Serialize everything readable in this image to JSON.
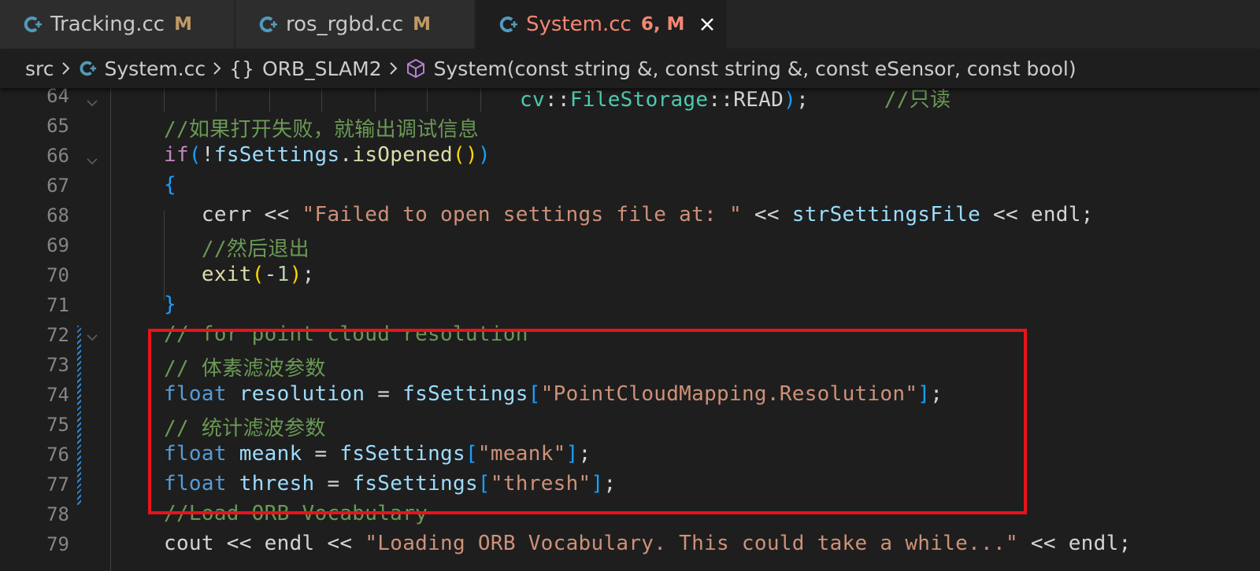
{
  "tabs": [
    {
      "label": "Tracking.cc",
      "badge": "M",
      "icon": "cpp-file-icon"
    },
    {
      "label": "ros_rgbd.cc",
      "badge": "M",
      "icon": "cpp-file-icon"
    },
    {
      "label": "System.cc",
      "badge": "6, M",
      "icon": "cpp-file-icon",
      "active": true
    }
  ],
  "breadcrumb": {
    "folder": "src",
    "file": "System.cc",
    "namespace_braces": "{}",
    "namespace": "ORB_SLAM2",
    "symbol": "System(const string &, const string &, const eSensor, const bool)"
  },
  "editor": {
    "lines": [
      {
        "n": "64",
        "tokens": [
          [
            "cv",
            "c-type"
          ],
          [
            "::",
            "c-plain"
          ],
          [
            "FileStorage",
            "c-type"
          ],
          [
            "::",
            "c-plain"
          ],
          [
            "READ",
            "c-plain"
          ],
          [
            ")",
            "c-p3"
          ],
          [
            ";",
            "c-plain"
          ],
          [
            "      ",
            "c-plain"
          ],
          [
            "//只读",
            "c-cmt"
          ]
        ]
      },
      {
        "n": "65",
        "tokens": [
          [
            "//如果打开失败，就输出调试信息",
            "c-cmt"
          ]
        ]
      },
      {
        "n": "66",
        "tokens": [
          [
            "if",
            "c-ctrl"
          ],
          [
            "(",
            "c-p3"
          ],
          [
            "!",
            "c-plain"
          ],
          [
            "fsSettings",
            "c-var"
          ],
          [
            ".",
            "c-plain"
          ],
          [
            "isOpened",
            "c-fn"
          ],
          [
            "(",
            "c-p1"
          ],
          [
            ")",
            "c-p1"
          ],
          [
            ")",
            "c-p3"
          ]
        ]
      },
      {
        "n": "67",
        "tokens": [
          [
            "{",
            "c-p3"
          ]
        ]
      },
      {
        "n": "68",
        "tokens": [
          [
            "   cerr ",
            "c-plain"
          ],
          [
            "<<",
            "c-plain"
          ],
          [
            " ",
            "c-plain"
          ],
          [
            "\"Failed to open settings file at: \"",
            "c-str"
          ],
          [
            " << ",
            "c-plain"
          ],
          [
            "strSettingsFile",
            "c-var"
          ],
          [
            " << endl;",
            "c-plain"
          ]
        ]
      },
      {
        "n": "69",
        "tokens": [
          [
            "   ",
            "c-plain"
          ],
          [
            "//然后退出",
            "c-cmt"
          ]
        ]
      },
      {
        "n": "70",
        "tokens": [
          [
            "   ",
            "c-plain"
          ],
          [
            "exit",
            "c-fn"
          ],
          [
            "(",
            "c-p1"
          ],
          [
            "-",
            "c-plain"
          ],
          [
            "1",
            "c-num"
          ],
          [
            ")",
            "c-p1"
          ],
          [
            ";",
            "c-plain"
          ]
        ]
      },
      {
        "n": "71",
        "tokens": [
          [
            "}",
            "c-p3"
          ]
        ]
      },
      {
        "n": "72",
        "tokens": [
          [
            "// for point cloud resolution",
            "c-cmt"
          ]
        ]
      },
      {
        "n": "73",
        "tokens": [
          [
            "// 体素滤波参数",
            "c-cmt"
          ]
        ]
      },
      {
        "n": "74",
        "tokens": [
          [
            "float",
            "c-kw"
          ],
          [
            " ",
            "c-plain"
          ],
          [
            "resolution",
            "c-var"
          ],
          [
            " = ",
            "c-plain"
          ],
          [
            "fsSettings",
            "c-var"
          ],
          [
            "[",
            "c-p3"
          ],
          [
            "\"PointCloudMapping.Resolution\"",
            "c-str"
          ],
          [
            "]",
            "c-p3"
          ],
          [
            ";",
            "c-plain"
          ]
        ]
      },
      {
        "n": "75",
        "tokens": [
          [
            "// 统计滤波参数",
            "c-cmt"
          ]
        ]
      },
      {
        "n": "76",
        "tokens": [
          [
            "float",
            "c-kw"
          ],
          [
            " ",
            "c-plain"
          ],
          [
            "meank",
            "c-var"
          ],
          [
            " = ",
            "c-plain"
          ],
          [
            "fsSettings",
            "c-var"
          ],
          [
            "[",
            "c-p3"
          ],
          [
            "\"meank\"",
            "c-str"
          ],
          [
            "]",
            "c-p3"
          ],
          [
            ";",
            "c-plain"
          ]
        ]
      },
      {
        "n": "77",
        "tokens": [
          [
            "float",
            "c-kw"
          ],
          [
            " ",
            "c-plain"
          ],
          [
            "thresh",
            "c-var"
          ],
          [
            " = ",
            "c-plain"
          ],
          [
            "fsSettings",
            "c-var"
          ],
          [
            "[",
            "c-p3"
          ],
          [
            "\"thresh\"",
            "c-str"
          ],
          [
            "]",
            "c-p3"
          ],
          [
            ";",
            "c-plain"
          ]
        ]
      },
      {
        "n": "78",
        "tokens": [
          [
            "//Load ORB Vocabulary",
            "c-cmt"
          ]
        ]
      },
      {
        "n": "79",
        "tokens": [
          [
            "cout ",
            "c-plain"
          ],
          [
            "<<",
            "c-plain"
          ],
          [
            " endl ",
            "c-plain"
          ],
          [
            "<<",
            "c-plain"
          ],
          [
            " ",
            "c-plain"
          ],
          [
            "\"Loading ORB Vocabulary. This could take a while...\"",
            "c-str"
          ],
          [
            " << endl;",
            "c-plain"
          ]
        ]
      }
    ]
  },
  "colors": {
    "highlight_box": "#e8131a",
    "active_tab_text": "#f48771",
    "modified_badge": "#c09a65",
    "cpp_icon": "#519aba"
  }
}
